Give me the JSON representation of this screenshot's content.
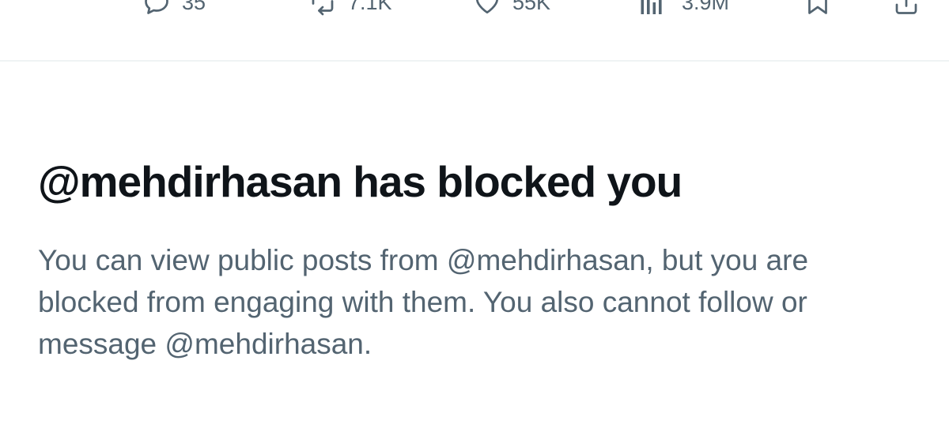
{
  "colors": {
    "primary_text": "#0f1419",
    "secondary_text": "#536471",
    "divider": "#eff3f4",
    "background": "#ffffff"
  },
  "tweet_actions": {
    "reply": {
      "icon": "reply-icon",
      "count": "35"
    },
    "repost": {
      "icon": "repost-icon",
      "count": "7.1K"
    },
    "like": {
      "icon": "heart-icon",
      "count": "55K"
    },
    "views": {
      "icon": "views-icon",
      "count": "3.9M"
    },
    "bookmark": {
      "icon": "bookmark-icon"
    },
    "share": {
      "icon": "share-icon"
    }
  },
  "blocked_notice": {
    "title": "@mehdirhasan has blocked you",
    "message": "You can view public posts from @mehdirhasan, but you are blocked from engaging with them. You also cannot follow or message @mehdirhasan."
  }
}
